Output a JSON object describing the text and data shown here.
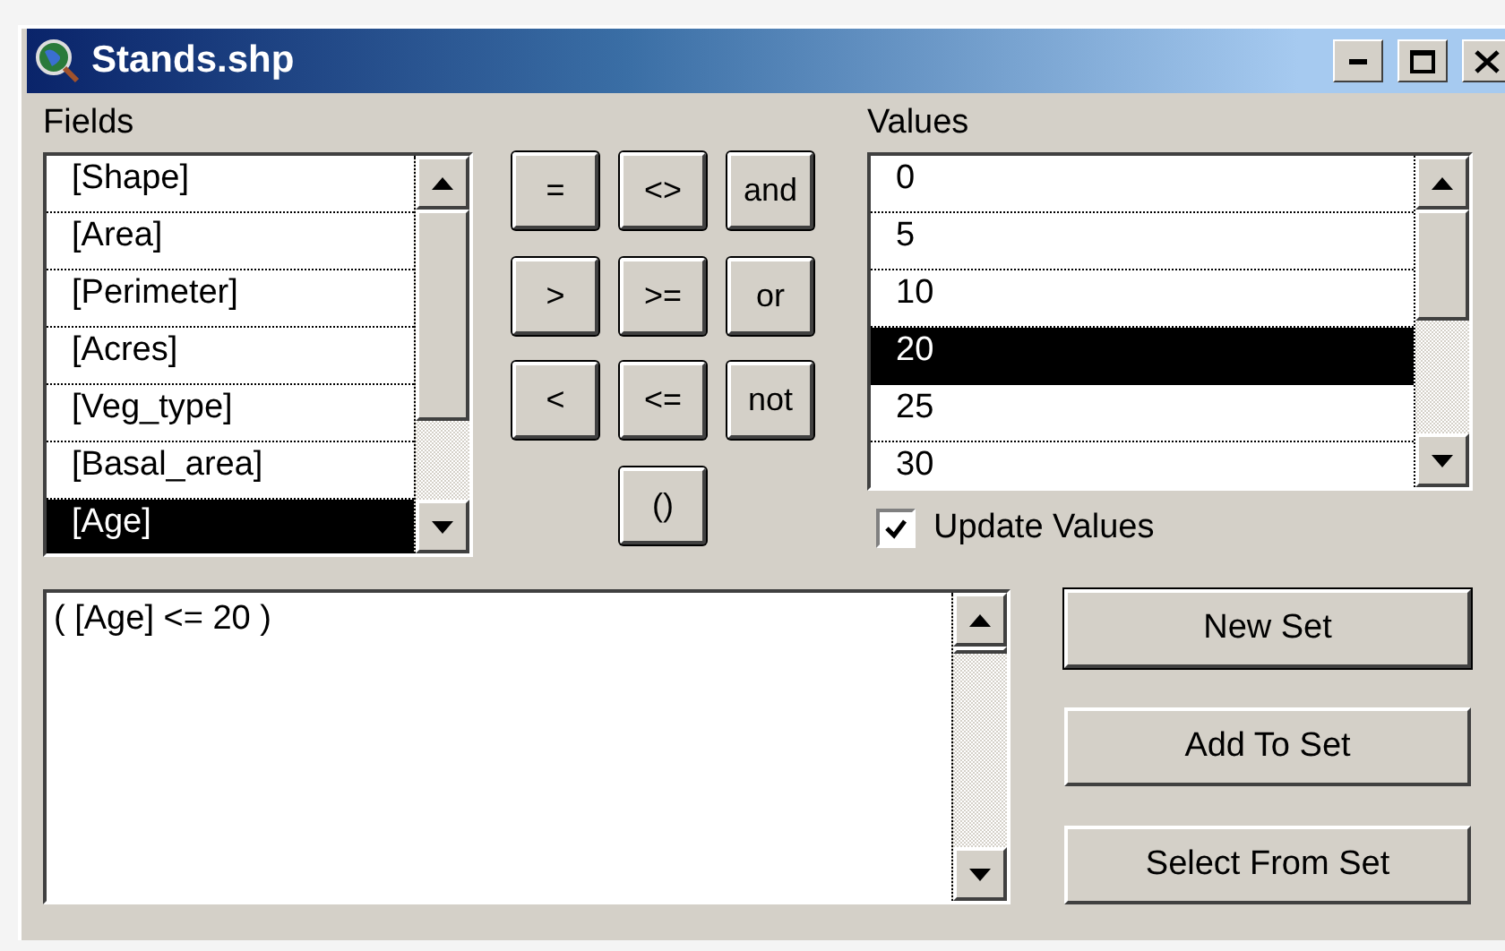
{
  "window": {
    "title": "Stands.shp"
  },
  "fields": {
    "label": "Fields",
    "items": [
      {
        "text": "[Shape]",
        "selected": false
      },
      {
        "text": "[Area]",
        "selected": false
      },
      {
        "text": "[Perimeter]",
        "selected": false
      },
      {
        "text": "[Acres]",
        "selected": false
      },
      {
        "text": "[Veg_type]",
        "selected": false
      },
      {
        "text": "[Basal_area]",
        "selected": false
      },
      {
        "text": "[Age]",
        "selected": true
      }
    ]
  },
  "operators": [
    [
      "=",
      "<>",
      "and"
    ],
    [
      ">",
      ">=",
      "or"
    ],
    [
      "<",
      "<=",
      "not"
    ],
    [
      "()"
    ]
  ],
  "values": {
    "label": "Values",
    "items": [
      {
        "text": "0",
        "selected": false
      },
      {
        "text": "5",
        "selected": false
      },
      {
        "text": "10",
        "selected": false
      },
      {
        "text": "20",
        "selected": true
      },
      {
        "text": "25",
        "selected": false
      },
      {
        "text": "30",
        "selected": false
      }
    ]
  },
  "update_values": {
    "label": "Update Values",
    "checked": true
  },
  "expression": "( [Age] <= 20 )",
  "buttons": [
    {
      "label": "New Set",
      "default": true
    },
    {
      "label": "Add To Set",
      "default": false
    },
    {
      "label": "Select From Set",
      "default": false
    }
  ]
}
